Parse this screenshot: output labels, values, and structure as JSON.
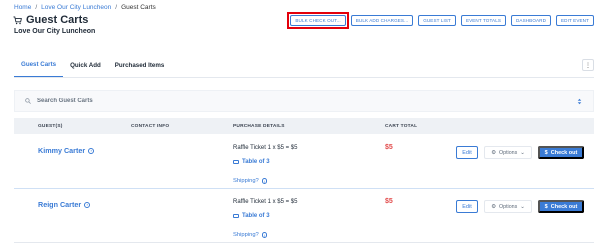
{
  "breadcrumb": {
    "home": "Home",
    "sep1": "/",
    "event": "Love Our City Luncheon",
    "sep2": "/",
    "current": "Guest Carts"
  },
  "header": {
    "title": "Guest Carts",
    "subtitle": "Love Our City Luncheon",
    "title_icon": "cart-icon"
  },
  "actions": {
    "bulk_checkout": "BULK CHECK OUT...",
    "bulk_add_charges": "BULK ADD CHARGES...",
    "guest_list": "GUEST LIST",
    "event_totals": "EVENT TOTALS",
    "dashboard": "DASHBOARD",
    "edit_event": "EDIT EVENT"
  },
  "tabs": [
    {
      "label": "Guest Carts",
      "active": true
    },
    {
      "label": "Quick Add",
      "active": false
    },
    {
      "label": "Purchased Items",
      "active": false
    }
  ],
  "tabs_menu_icon": "kebab-menu-icon",
  "search": {
    "placeholder": "Search Guest Carts",
    "icon": "search-icon",
    "filter_icon": "sort-icon"
  },
  "table": {
    "headers": {
      "guest": "GUEST(S)",
      "contact": "CONTACT INFO",
      "purchase": "PURCHASE DETAILS",
      "total": "CART TOTAL"
    },
    "rows": [
      {
        "name": "Kimmy Carter",
        "purchase": "Raffle Ticket 1 x $5 = $5",
        "table": "Table of 3",
        "shipping": "Shipping?",
        "total": "$5",
        "edit": "Edit",
        "options": "Options",
        "checkout": "Check out"
      },
      {
        "name": "Reign Carter",
        "purchase": "Raffle Ticket 1 x $5 = $5",
        "table": "Table of 3",
        "shipping": "Shipping?",
        "total": "$5",
        "edit": "Edit",
        "options": "Options",
        "checkout": "Check out"
      }
    ]
  },
  "colors": {
    "accent": "#3a7bd5",
    "highlight": "#e3000b",
    "total": "#e24a4a"
  }
}
